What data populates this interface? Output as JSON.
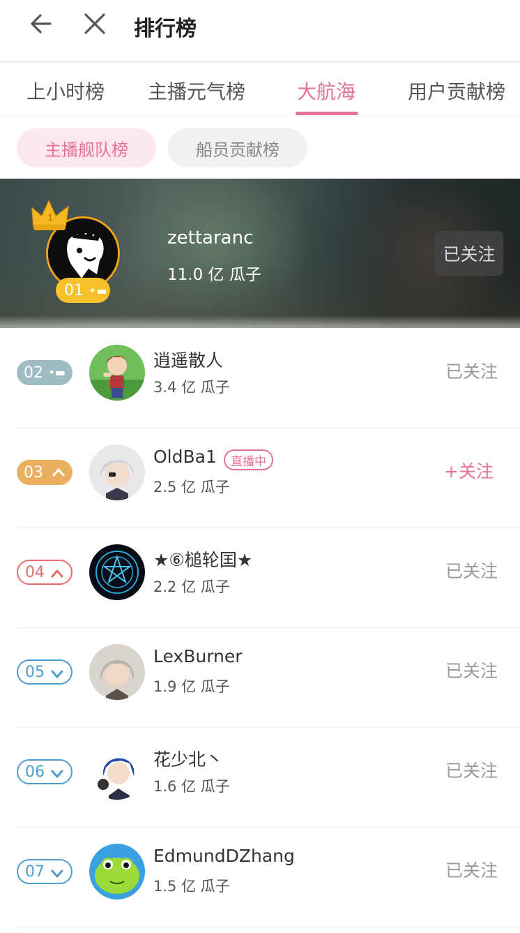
{
  "header": {
    "title": "排行榜"
  },
  "tabs": [
    "上小时榜",
    "主播元气榜",
    "大航海",
    "用户贡献榜"
  ],
  "active_tab_index": 2,
  "subtabs": [
    "主播舰队榜",
    "船员贡献榜"
  ],
  "active_subtab_index": 0,
  "accent_color": "#e8709a",
  "top_entry": {
    "rank": "01",
    "crown_number": "1",
    "name": "zettaranc",
    "score": "11.0 亿 瓜子",
    "follow_label": "已关注"
  },
  "entries": [
    {
      "rank": "02",
      "trend": "same",
      "name": "逍遥散人",
      "score": "3.4 亿 瓜子",
      "follow_label": "已关注",
      "live": false
    },
    {
      "rank": "03",
      "trend": "up-filled",
      "name": "OldBa1",
      "score": "2.5 亿 瓜子",
      "follow_label": "+关注",
      "live": true,
      "live_label": "直播中"
    },
    {
      "rank": "04",
      "trend": "up",
      "name": "★⑥槌轮囯★",
      "score": "2.2 亿 瓜子",
      "follow_label": "已关注",
      "live": false
    },
    {
      "rank": "05",
      "trend": "down",
      "name": "LexBurner",
      "score": "1.9 亿 瓜子",
      "follow_label": "已关注",
      "live": false
    },
    {
      "rank": "06",
      "trend": "down",
      "name": "花少北丶",
      "score": "1.6 亿 瓜子",
      "follow_label": "已关注",
      "live": false
    },
    {
      "rank": "07",
      "trend": "down",
      "name": "EdmundDZhang",
      "score": "1.5 亿 瓜子",
      "follow_label": "已关注",
      "live": false
    }
  ]
}
